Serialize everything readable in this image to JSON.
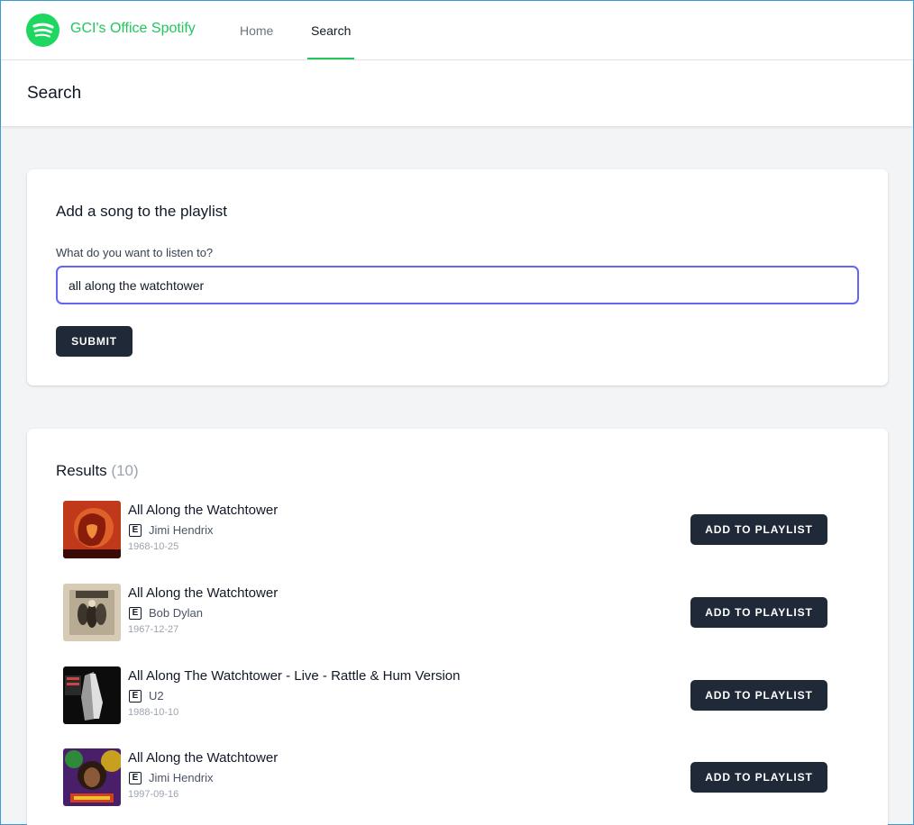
{
  "app": {
    "brand": "GCI's Office Spotify",
    "nav": [
      {
        "label": "Home",
        "active": false
      },
      {
        "label": "Search",
        "active": true
      }
    ],
    "accent_color": "#22c55e",
    "logo_icon": "spotify-logo-icon"
  },
  "page": {
    "title": "Search"
  },
  "search_form": {
    "title": "Add a song to the playlist",
    "label": "What do you want to listen to?",
    "value": "all along the watchtower",
    "submit_label": "SUBMIT"
  },
  "results": {
    "title": "Results",
    "count": "(10)",
    "items": [
      {
        "title": "All Along the Watchtower",
        "explicit": "E",
        "artist": "Jimi Hendrix",
        "date": "1968-10-25",
        "button": "ADD TO PLAYLIST",
        "cover_icon": "electric-ladyland-cover"
      },
      {
        "title": "All Along the Watchtower",
        "explicit": "E",
        "artist": "Bob Dylan",
        "date": "1967-12-27",
        "button": "ADD TO PLAYLIST",
        "cover_icon": "john-wesley-harding-cover"
      },
      {
        "title": "All Along The Watchtower - Live - Rattle & Hum Version",
        "explicit": "E",
        "artist": "U2",
        "date": "1988-10-10",
        "button": "ADD TO PLAYLIST",
        "cover_icon": "rattle-and-hum-cover"
      },
      {
        "title": "All Along the Watchtower",
        "explicit": "E",
        "artist": "Jimi Hendrix",
        "date": "1997-09-16",
        "button": "ADD TO PLAYLIST",
        "cover_icon": "experience-hendrix-cover"
      }
    ]
  }
}
